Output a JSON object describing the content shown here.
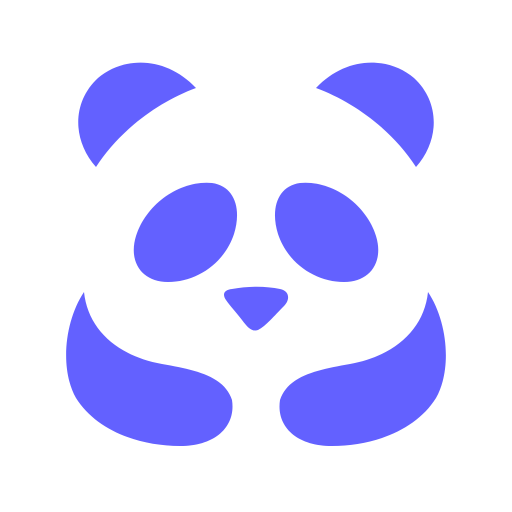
{
  "logo": {
    "name": "panda-logo-icon",
    "background_color": "#ffffff",
    "fill_color": "#6361ff"
  }
}
